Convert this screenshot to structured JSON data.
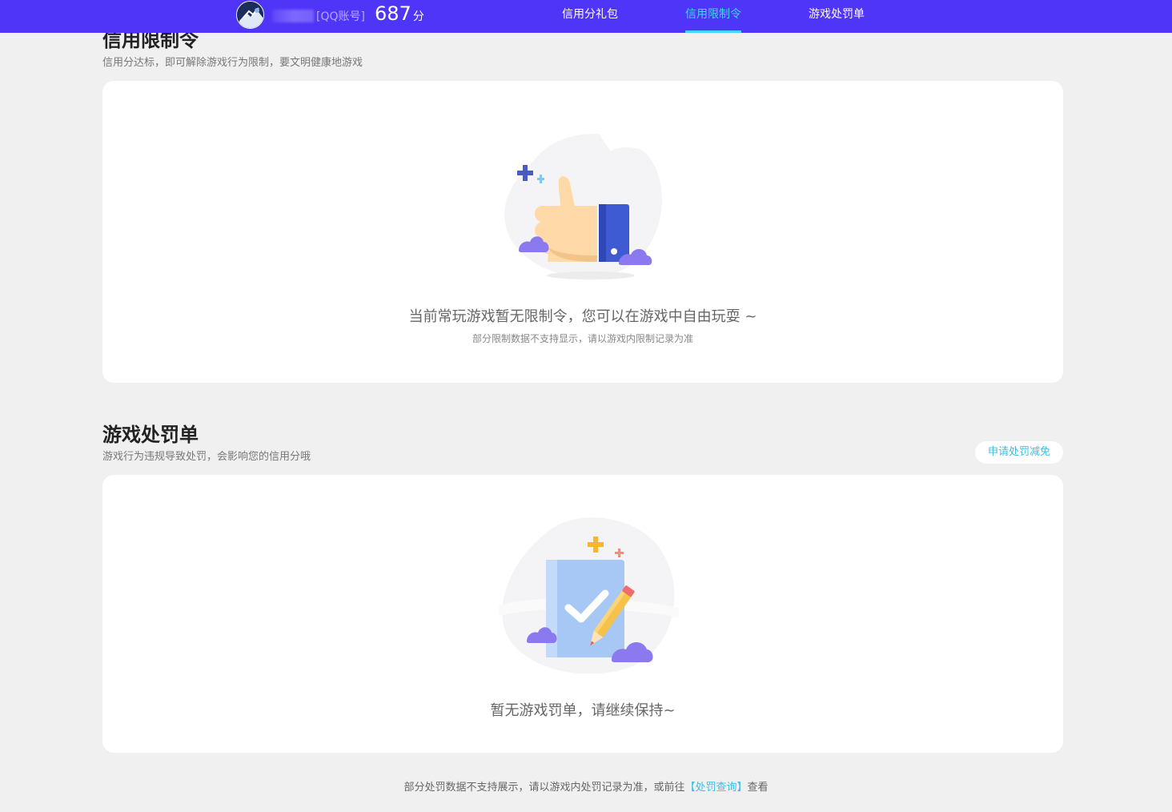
{
  "header": {
    "account_type": "[QQ账号]",
    "score": "687",
    "score_unit": "分",
    "nav": [
      {
        "label": "信用分礼包",
        "active": false
      },
      {
        "label": "信用限制令",
        "active": true
      },
      {
        "label": "游戏处罚单",
        "active": false
      }
    ],
    "brand_color": "#4f35f8",
    "active_color": "#41d6ff"
  },
  "restriction": {
    "title": "信用限制令",
    "subtitle": "信用分达标，即可解除游戏行为限制，要文明健康地游戏",
    "empty_text": "当前常玩游戏暂无限制令，您可以在游戏中自由玩耍 ~",
    "note": "部分限制数据不支持显示，请以游戏内限制记录为准",
    "illustration_icon": "thumbs-up-icon"
  },
  "penalty": {
    "title": "游戏处罚单",
    "subtitle": "游戏行为违规导致处罚，会影响您的信用分哦",
    "appeal_button": "申请处罚减免",
    "empty_text": "暂无游戏罚单，请继续保持~",
    "illustration_icon": "clipboard-check-icon"
  },
  "footer": {
    "text_before": "部分处罚数据不支持展示，请以游戏内处罚记录为准，或前往",
    "link": "【处罚查询】",
    "text_after": "查看"
  }
}
